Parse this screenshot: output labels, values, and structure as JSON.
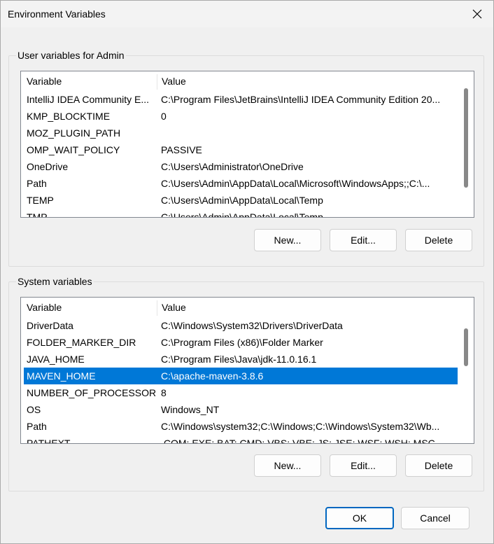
{
  "window": {
    "title": "Environment Variables",
    "close_icon": "close-icon"
  },
  "user_vars": {
    "group_label": "User variables for Admin",
    "col_variable": "Variable",
    "col_value": "Value",
    "rows": [
      {
        "name": "IntelliJ IDEA Community E...",
        "value": "C:\\Program Files\\JetBrains\\IntelliJ IDEA Community Edition 20..."
      },
      {
        "name": "KMP_BLOCKTIME",
        "value": "0"
      },
      {
        "name": "MOZ_PLUGIN_PATH",
        "value": ""
      },
      {
        "name": "OMP_WAIT_POLICY",
        "value": "PASSIVE"
      },
      {
        "name": "OneDrive",
        "value": "C:\\Users\\Administrator\\OneDrive"
      },
      {
        "name": "Path",
        "value": "C:\\Users\\Admin\\AppData\\Local\\Microsoft\\WindowsApps;;C:\\..."
      },
      {
        "name": "TEMP",
        "value": "C:\\Users\\Admin\\AppData\\Local\\Temp"
      },
      {
        "name": "TMP",
        "value": "C:\\Users\\Admin\\AppData\\Local\\Temp"
      }
    ],
    "new_label": "New...",
    "edit_label": "Edit...",
    "delete_label": "Delete"
  },
  "system_vars": {
    "group_label": "System variables",
    "col_variable": "Variable",
    "col_value": "Value",
    "rows": [
      {
        "name": "DriverData",
        "value": "C:\\Windows\\System32\\Drivers\\DriverData"
      },
      {
        "name": "FOLDER_MARKER_DIR",
        "value": "C:\\Program Files (x86)\\Folder Marker"
      },
      {
        "name": "JAVA_HOME",
        "value": "C:\\Program Files\\Java\\jdk-11.0.16.1"
      },
      {
        "name": "MAVEN_HOME",
        "value": "C:\\apache-maven-3.8.6"
      },
      {
        "name": "NUMBER_OF_PROCESSORS",
        "value": "8"
      },
      {
        "name": "OS",
        "value": "Windows_NT"
      },
      {
        "name": "Path",
        "value": "C:\\Windows\\system32;C:\\Windows;C:\\Windows\\System32\\Wb..."
      },
      {
        "name": "PATHEXT",
        "value": ".COM;.EXE;.BAT;.CMD;.VBS;.VBE;.JS;.JSE;.WSF;.WSH;.MSC"
      }
    ],
    "selected_row": "MAVEN_HOME",
    "new_label": "New...",
    "edit_label": "Edit...",
    "delete_label": "Delete"
  },
  "footer": {
    "ok_label": "OK",
    "cancel_label": "Cancel"
  },
  "colors": {
    "selection": "#0078d7",
    "default_button_border": "#0067c0"
  }
}
